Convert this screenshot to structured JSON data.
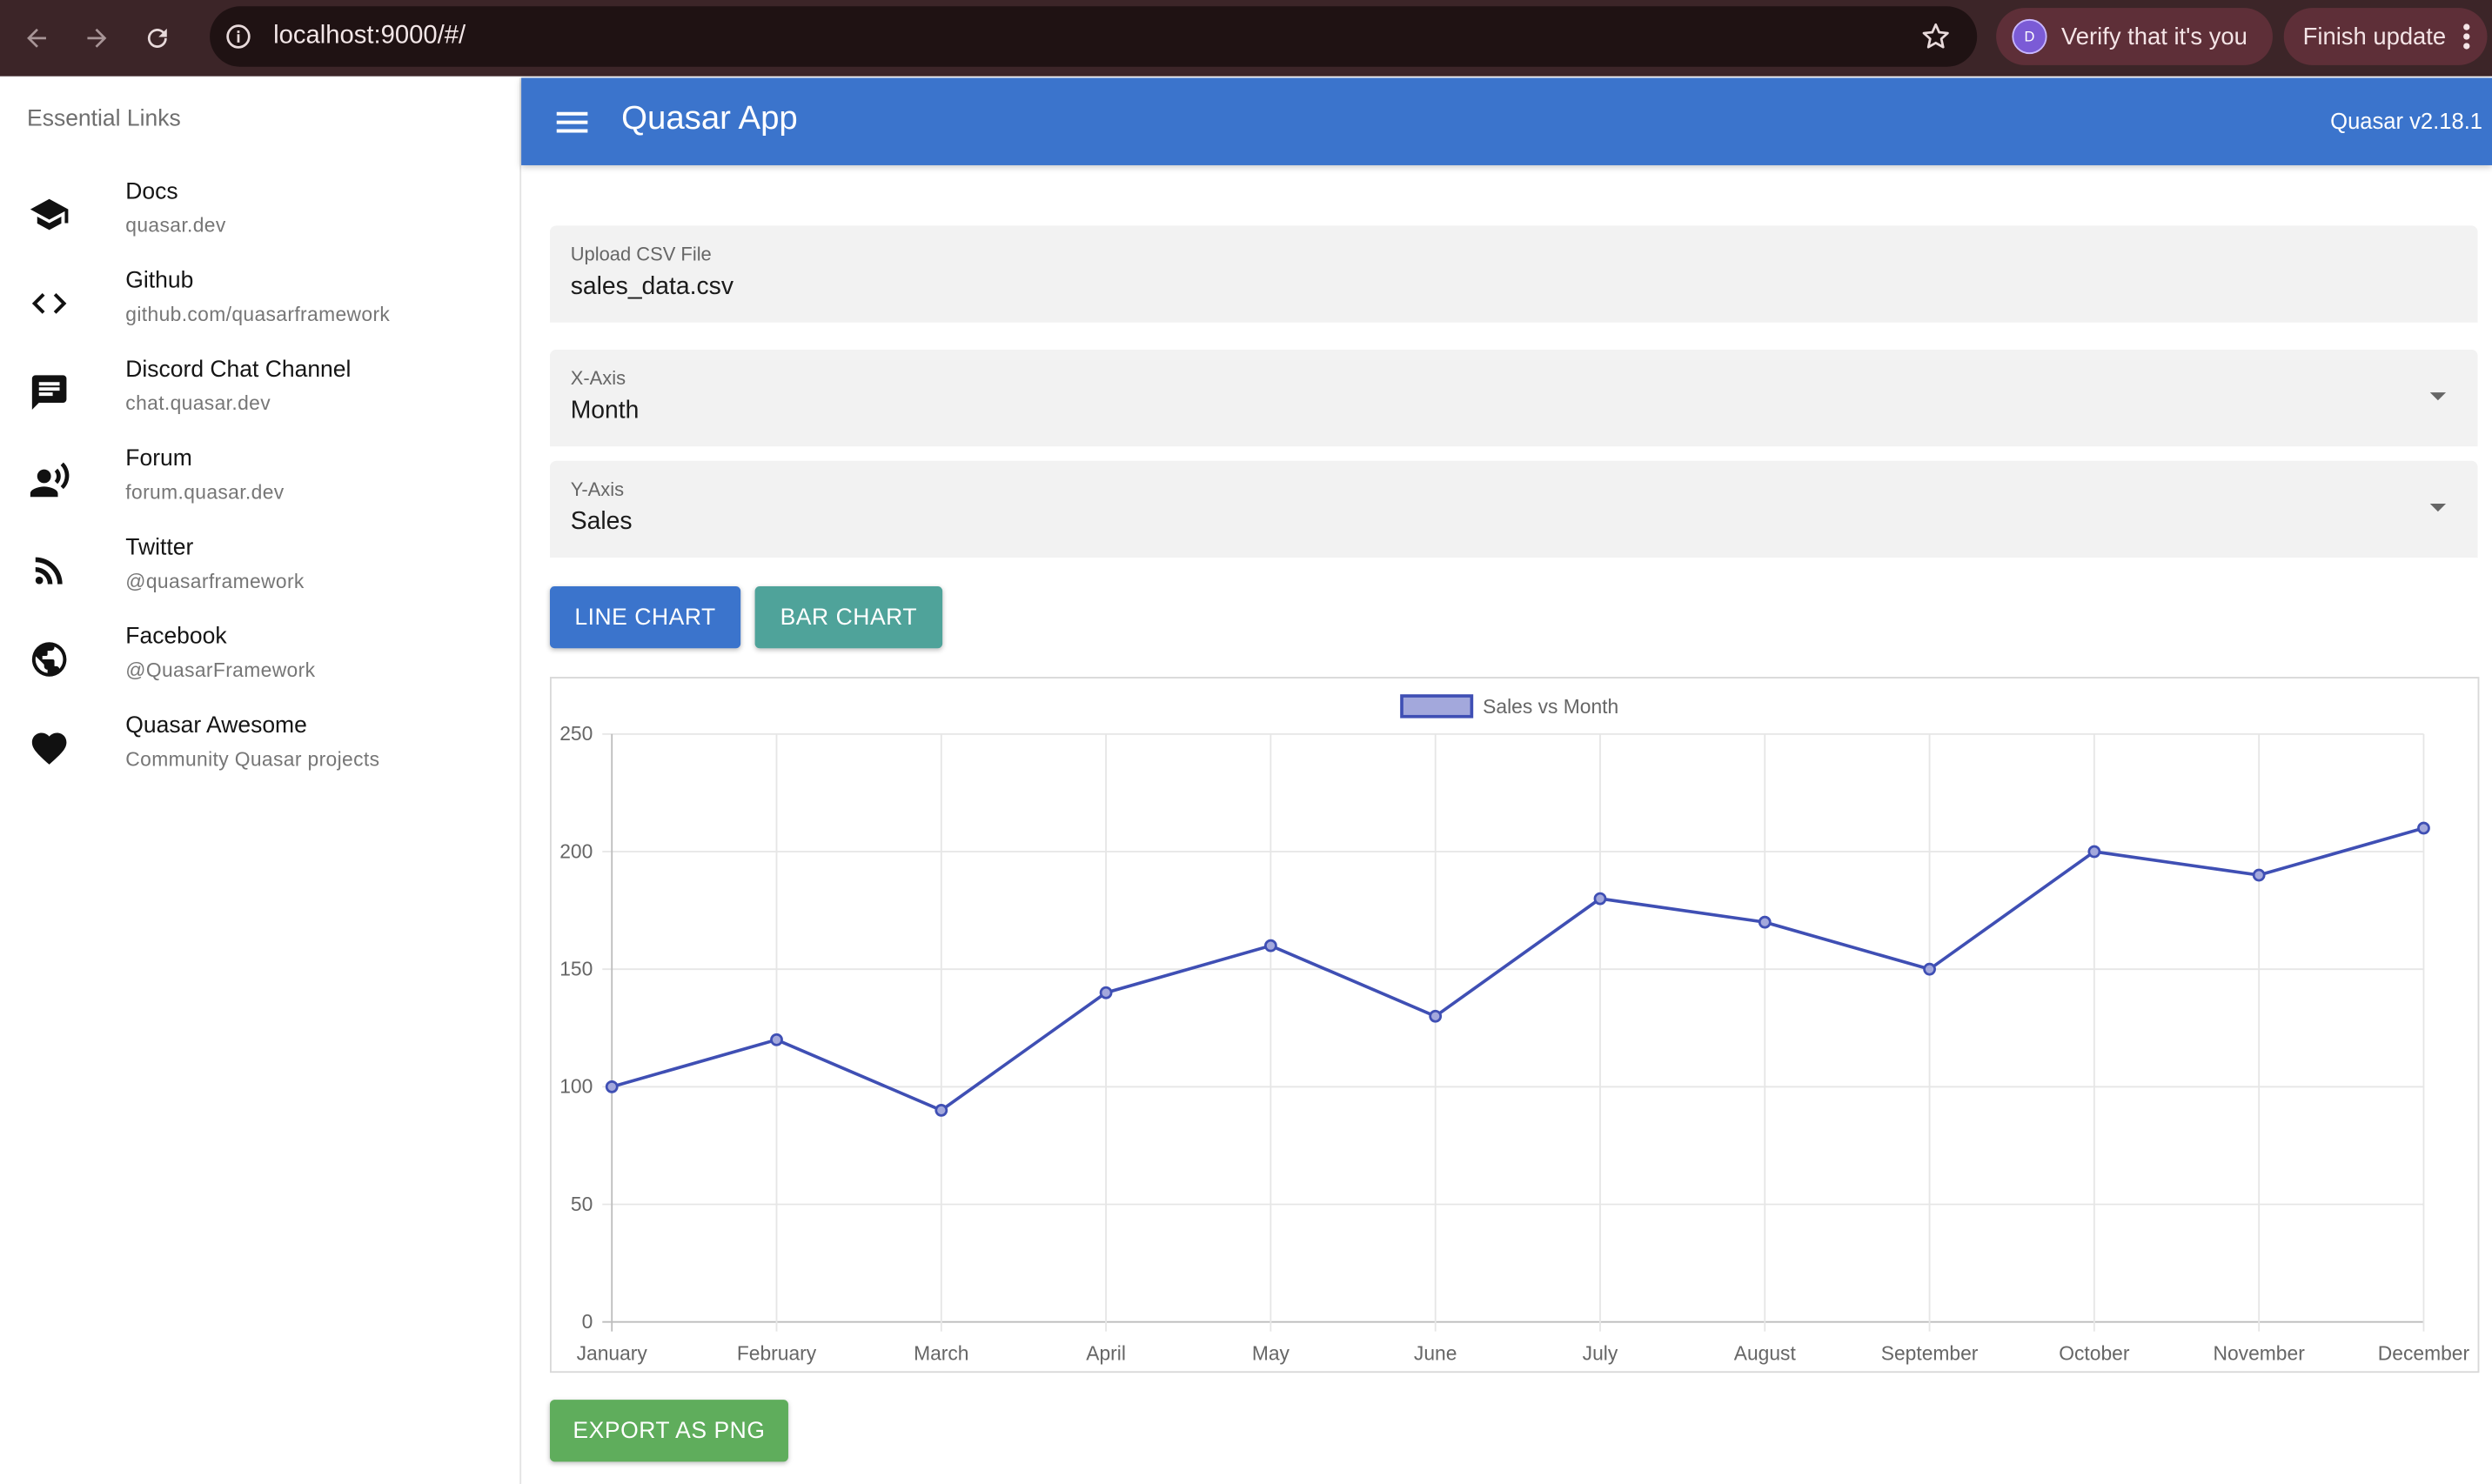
{
  "browser": {
    "url": "localhost:9000/#/",
    "verify_label": "Verify that it's you",
    "avatar_letter": "D",
    "finish_label": "Finish update"
  },
  "drawer": {
    "header": "Essential Links",
    "items": [
      {
        "title": "Docs",
        "caption": "quasar.dev",
        "icon": "school-icon"
      },
      {
        "title": "Github",
        "caption": "github.com/quasarframework",
        "icon": "code-icon"
      },
      {
        "title": "Discord Chat Channel",
        "caption": "chat.quasar.dev",
        "icon": "chat-icon"
      },
      {
        "title": "Forum",
        "caption": "forum.quasar.dev",
        "icon": "record-voice-icon"
      },
      {
        "title": "Twitter",
        "caption": "@quasarframework",
        "icon": "rss-feed-icon"
      },
      {
        "title": "Facebook",
        "caption": "@QuasarFramework",
        "icon": "public-icon"
      },
      {
        "title": "Quasar Awesome",
        "caption": "Community Quasar projects",
        "icon": "favorite-icon"
      }
    ]
  },
  "header": {
    "title": "Quasar App",
    "version": "Quasar v2.18.1"
  },
  "form": {
    "upload": {
      "label": "Upload CSV File",
      "value": "sales_data.csv"
    },
    "x_axis": {
      "label": "X-Axis",
      "value": "Month"
    },
    "y_axis": {
      "label": "Y-Axis",
      "value": "Sales"
    }
  },
  "buttons": {
    "line_chart": "LINE CHART",
    "bar_chart": "BAR CHART",
    "export": "EXPORT AS PNG"
  },
  "colors": {
    "primary": "#3b74cc",
    "secondary": "#4fa39a",
    "positive": "#5fad5c",
    "series_line": "#3f4fb4",
    "series_fill": "#a3a8dc"
  },
  "chart_data": {
    "type": "line",
    "categories": [
      "January",
      "February",
      "March",
      "April",
      "May",
      "June",
      "July",
      "August",
      "September",
      "October",
      "November",
      "December"
    ],
    "series": [
      {
        "name": "Sales vs Month",
        "values": [
          100,
          120,
          90,
          140,
          160,
          130,
          180,
          170,
          150,
          200,
          190,
          210
        ]
      }
    ],
    "ylim": [
      0,
      250
    ],
    "yticks": [
      0,
      50,
      100,
      150,
      200,
      250
    ],
    "grid": true,
    "legend": "top-center"
  }
}
